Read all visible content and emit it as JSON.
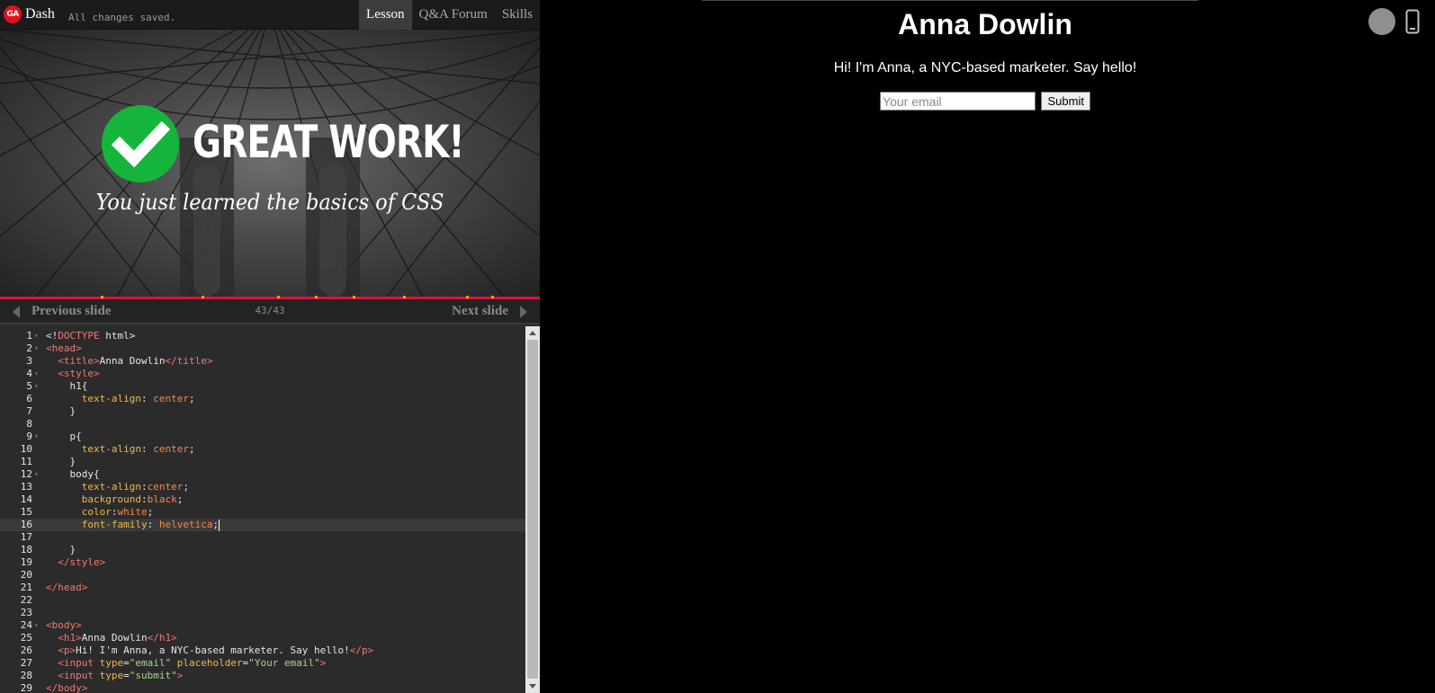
{
  "header": {
    "logo_text": "GA",
    "brand": "Dash",
    "save_status": "All changes saved.",
    "tabs": [
      "Lesson",
      "Q&A Forum",
      "Skills"
    ],
    "active_tab": "Lesson"
  },
  "hero": {
    "title": "GREAT WORK!",
    "subtitle": "You just learned the basics of CSS",
    "icon": "check-icon",
    "colors": {
      "check_circle": "#14b53a",
      "progress_bar": "#d9133d"
    }
  },
  "slide_nav": {
    "prev_label": "Previous slide",
    "counter": "43/43",
    "next_label": "Next slide"
  },
  "editor": {
    "current_line": 16,
    "lines": [
      {
        "n": "1",
        "fold": true,
        "html": "&lt;!<span class='t'>DOCTYPE</span> html&gt;"
      },
      {
        "n": "2",
        "fold": true,
        "html": "<span class='t'>&lt;head&gt;</span>"
      },
      {
        "n": "3",
        "fold": false,
        "html": "  <span class='t'>&lt;title&gt;</span>Anna Dowlin<span class='t'>&lt;/title&gt;</span>"
      },
      {
        "n": "4",
        "fold": true,
        "html": "  <span class='t'>&lt;style&gt;</span>"
      },
      {
        "n": "5",
        "fold": true,
        "html": "    h1{"
      },
      {
        "n": "6",
        "fold": false,
        "html": "      <span class='a'>text-align</span>: <span class='v'>center</span>;"
      },
      {
        "n": "7",
        "fold": false,
        "html": "    }"
      },
      {
        "n": "8",
        "fold": false,
        "html": ""
      },
      {
        "n": "9",
        "fold": true,
        "html": "    p{"
      },
      {
        "n": "10",
        "fold": false,
        "html": "      <span class='a'>text-align</span>: <span class='v'>center</span>;"
      },
      {
        "n": "11",
        "fold": false,
        "html": "    }"
      },
      {
        "n": "12",
        "fold": true,
        "html": "    body{"
      },
      {
        "n": "13",
        "fold": false,
        "html": "      <span class='a'>text-align</span>:<span class='v'>center</span>;"
      },
      {
        "n": "14",
        "fold": false,
        "html": "      <span class='a'>background</span>:<span class='v'>black</span>;"
      },
      {
        "n": "15",
        "fold": false,
        "html": "      <span class='a'>color</span>:<span class='v'>white</span>;"
      },
      {
        "n": "16",
        "fold": false,
        "html": "      <span class='a'>font-family</span>: <span class='v'>helvetica</span>;<span class='cursor'></span>"
      },
      {
        "n": "17",
        "fold": false,
        "html": ""
      },
      {
        "n": "18",
        "fold": false,
        "html": "    }"
      },
      {
        "n": "19",
        "fold": false,
        "html": "  <span class='t'>&lt;/style&gt;</span>"
      },
      {
        "n": "20",
        "fold": false,
        "html": ""
      },
      {
        "n": "21",
        "fold": false,
        "html": "<span class='t'>&lt;/head&gt;</span>"
      },
      {
        "n": "22",
        "fold": false,
        "html": ""
      },
      {
        "n": "23",
        "fold": false,
        "html": ""
      },
      {
        "n": "24",
        "fold": true,
        "html": "<span class='t'>&lt;body&gt;</span>"
      },
      {
        "n": "25",
        "fold": false,
        "html": "  <span class='t'>&lt;h1&gt;</span>Anna Dowlin<span class='t'>&lt;/h1&gt;</span>"
      },
      {
        "n": "26",
        "fold": false,
        "html": "  <span class='t'>&lt;p&gt;</span>Hi! I'm Anna, a NYC-based marketer. Say hello!<span class='t'>&lt;/p&gt;</span>"
      },
      {
        "n": "27",
        "fold": false,
        "html": "  <span class='t'>&lt;input</span> <span class='a'>type</span>=<span class='s'>\"email\"</span> <span class='a'>placeholder</span>=<span class='s'>\"Your email\"</span><span class='t'>&gt;</span>"
      },
      {
        "n": "28",
        "fold": false,
        "html": "  <span class='t'>&lt;input</span> <span class='a'>type</span>=<span class='s'>\"submit\"</span><span class='t'>&gt;</span>"
      },
      {
        "n": "29",
        "fold": false,
        "html": "<span class='t'>&lt;/body&gt;</span>"
      }
    ]
  },
  "preview": {
    "heading": "Anna Dowlin",
    "text": "Hi! I'm Anna, a NYC-based marketer. Say hello!",
    "email_placeholder": "Your email",
    "submit_label": "Submit",
    "icons": [
      "view-toggle-circle-icon",
      "mobile-device-icon"
    ]
  }
}
